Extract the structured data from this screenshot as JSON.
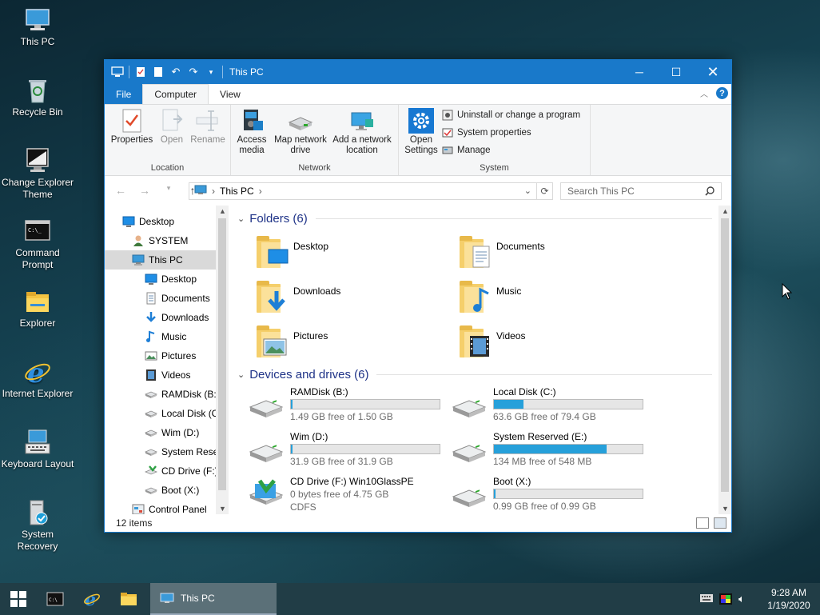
{
  "desktop": {
    "icons": [
      {
        "label": "This PC"
      },
      {
        "label": "Recycle Bin"
      },
      {
        "label": "Change Explorer Theme"
      },
      {
        "label": "Command Prompt"
      },
      {
        "label": "Explorer"
      },
      {
        "label": "Internet Explorer"
      },
      {
        "label": "Keyboard Layout"
      },
      {
        "label": "System Recovery"
      }
    ]
  },
  "window": {
    "title": "This PC",
    "tabs": {
      "file": "File",
      "computer": "Computer",
      "view": "View"
    },
    "ribbon": {
      "location": {
        "label": "Location",
        "properties": "Properties",
        "open": "Open",
        "rename": "Rename"
      },
      "network": {
        "label": "Network",
        "access_media": "Access media",
        "map_drive": "Map network drive",
        "add_location": "Add a network location"
      },
      "system": {
        "label": "System",
        "open_settings": "Open Settings",
        "uninstall": "Uninstall or change a program",
        "system_properties": "System properties",
        "manage": "Manage"
      }
    },
    "address": {
      "path": "This PC",
      "search_placeholder": "Search This PC"
    },
    "nav_tree": [
      {
        "label": "Desktop",
        "indent": 0,
        "icon": "desktop-icon"
      },
      {
        "label": "SYSTEM",
        "indent": 1,
        "icon": "user-icon"
      },
      {
        "label": "This PC",
        "indent": 1,
        "icon": "computer-icon",
        "selected": true
      },
      {
        "label": "Desktop",
        "indent": 2,
        "icon": "desktop-icon"
      },
      {
        "label": "Documents",
        "indent": 2,
        "icon": "document-icon"
      },
      {
        "label": "Downloads",
        "indent": 2,
        "icon": "download-icon"
      },
      {
        "label": "Music",
        "indent": 2,
        "icon": "music-icon"
      },
      {
        "label": "Pictures",
        "indent": 2,
        "icon": "picture-icon"
      },
      {
        "label": "Videos",
        "indent": 2,
        "icon": "video-icon"
      },
      {
        "label": "RAMDisk (B:)",
        "indent": 2,
        "icon": "drive-icon"
      },
      {
        "label": "Local Disk (C:)",
        "indent": 2,
        "icon": "drive-icon"
      },
      {
        "label": "Wim (D:)",
        "indent": 2,
        "icon": "drive-icon"
      },
      {
        "label": "System Reserved",
        "indent": 2,
        "icon": "drive-icon"
      },
      {
        "label": "CD Drive (F:) W",
        "indent": 2,
        "icon": "cd-drive-icon"
      },
      {
        "label": "Boot (X:)",
        "indent": 2,
        "icon": "drive-icon"
      },
      {
        "label": "Control Panel",
        "indent": 1,
        "icon": "control-panel-icon"
      }
    ],
    "folders_header": "Folders (6)",
    "folders": [
      {
        "label": "Desktop",
        "badge": "desktop"
      },
      {
        "label": "Documents",
        "badge": "documents"
      },
      {
        "label": "Downloads",
        "badge": "downloads"
      },
      {
        "label": "Music",
        "badge": "music"
      },
      {
        "label": "Pictures",
        "badge": "pictures"
      },
      {
        "label": "Videos",
        "badge": "videos"
      }
    ],
    "drives_header": "Devices and drives (6)",
    "drives": [
      {
        "label": "RAMDisk (B:)",
        "free": "1.49 GB free of 1.50 GB",
        "used_fraction": 0.01,
        "type": "hdd"
      },
      {
        "label": "Local Disk (C:)",
        "free": "63.6 GB free of 79.4 GB",
        "used_fraction": 0.2,
        "type": "hdd"
      },
      {
        "label": "Wim (D:)",
        "free": "31.9 GB free of 31.9 GB",
        "used_fraction": 0.0,
        "type": "hdd"
      },
      {
        "label": "System Reserved (E:)",
        "free": "134 MB free of 548 MB",
        "used_fraction": 0.76,
        "type": "hdd"
      },
      {
        "label": "CD Drive (F:) Win10GlassPE",
        "free": "0 bytes free of 4.75 GB",
        "fs": "CDFS",
        "type": "cd"
      },
      {
        "label": "Boot (X:)",
        "free": "0.99 GB free of 0.99 GB",
        "used_fraction": 0.0,
        "type": "hdd"
      }
    ],
    "status": "12 items"
  },
  "taskbar": {
    "task_label": "This PC",
    "time": "9:28 AM",
    "date": "1/19/2020"
  },
  "colors": {
    "accent": "#1979ca",
    "bar_fill": "#26a0da",
    "folder": "#f5cf6b"
  }
}
